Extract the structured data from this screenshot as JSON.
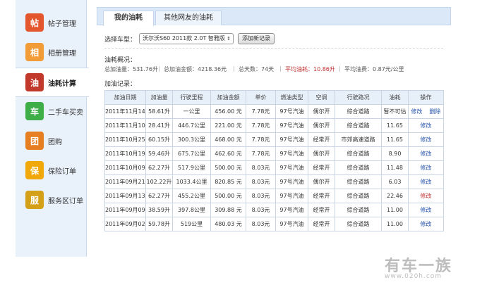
{
  "sidebar": {
    "items": [
      {
        "label": "帖子管理",
        "icon": "post-icon",
        "color": "#e4572e",
        "glyph": "帖"
      },
      {
        "label": "相册管理",
        "icon": "album-icon",
        "color": "#f29c38",
        "glyph": "相"
      },
      {
        "label": "油耗计算",
        "icon": "fuel-icon",
        "color": "#c0392b",
        "glyph": "油"
      },
      {
        "label": "二手车买卖",
        "icon": "used-car-icon",
        "color": "#3fae49",
        "glyph": "车"
      },
      {
        "label": "团购",
        "icon": "group-buy-icon",
        "color": "#e67e22",
        "glyph": "团"
      },
      {
        "label": "保险订单",
        "icon": "insurance-icon",
        "color": "#f1a80a",
        "glyph": "保"
      },
      {
        "label": "服务区订单",
        "icon": "service-icon",
        "color": "#d4a017",
        "glyph": "服"
      }
    ]
  },
  "tabs": [
    {
      "label": "我的油耗"
    },
    {
      "label": "其他网友的油耗"
    }
  ],
  "vehicle": {
    "label": "选择车型：",
    "selected": "沃尔沃S60 2011款 2.0T 智雅版",
    "add_button": "添加新记录"
  },
  "summary": {
    "title": "油耗概况：",
    "total_fuel": "总加油量：531.76升",
    "total_cost": "总加油金额：4218.36元",
    "total_days": "总天数：74天",
    "avg_consumption": "平均油耗：10.86升",
    "avg_cost": "平均油费：0.87元/公里",
    "sep": "|"
  },
  "records": {
    "title": "加油记录：",
    "headers": [
      "加油日期",
      "加油量",
      "行驶里程",
      "加油金额",
      "单价",
      "燃油类型",
      "空调",
      "行驶路况",
      "油耗",
      "操作"
    ],
    "rows": [
      [
        "2011年11月14日",
        "58.61升",
        "一公里",
        "456.00 元",
        "7.78元",
        "97号汽油",
        "偶尔开",
        "综合道路",
        "暂不可估",
        "修改",
        "删除"
      ],
      [
        "2011年11月10日",
        "28.41升",
        "446.7公里",
        "221.00 元",
        "7.78元",
        "97号汽油",
        "偶尔开",
        "综合道路",
        "11.65",
        "修改",
        ""
      ],
      [
        "2011年10月25日",
        "60.15升",
        "300.3公里",
        "468.00 元",
        "7.78元",
        "97号汽油",
        "经常开",
        "市郊高速道路",
        "11.65",
        "修改",
        ""
      ],
      [
        "2011年10月19日",
        "59.46升",
        "675.7公里",
        "462.60 元",
        "7.78元",
        "97号汽油",
        "偶尔开",
        "综合道路",
        "8.90",
        "修改",
        ""
      ],
      [
        "2011年10月09日",
        "62.27升",
        "517.9公里",
        "500.00 元",
        "8.03元",
        "97号汽油",
        "经常开",
        "综合道路",
        "11.48",
        "修改",
        ""
      ],
      [
        "2011年09月21日",
        "102.22升",
        "1033.4公里",
        "820.85 元",
        "8.03元",
        "97号汽油",
        "偶尔开",
        "综合道路",
        "6.03",
        "修改",
        ""
      ],
      [
        "2011年09月13日",
        "62.27升",
        "455.2公里",
        "500.00 元",
        "8.03元",
        "97号汽油",
        "经常开",
        "综合道路",
        "22.46",
        "修改",
        ""
      ],
      [
        "2011年09月09日",
        "38.59升",
        "397.8公里",
        "309.88 元",
        "8.03元",
        "97号汽油",
        "经常开",
        "综合道路",
        "11.00",
        "修改",
        ""
      ],
      [
        "2011年09月02日",
        "59.78升",
        "519公里",
        "480.03 元",
        "8.03元",
        "97号汽油",
        "经常开",
        "综合道路",
        "11.00",
        "修改",
        ""
      ]
    ]
  },
  "watermark": {
    "logo": "有车一族",
    "url": "www.020h.com"
  }
}
